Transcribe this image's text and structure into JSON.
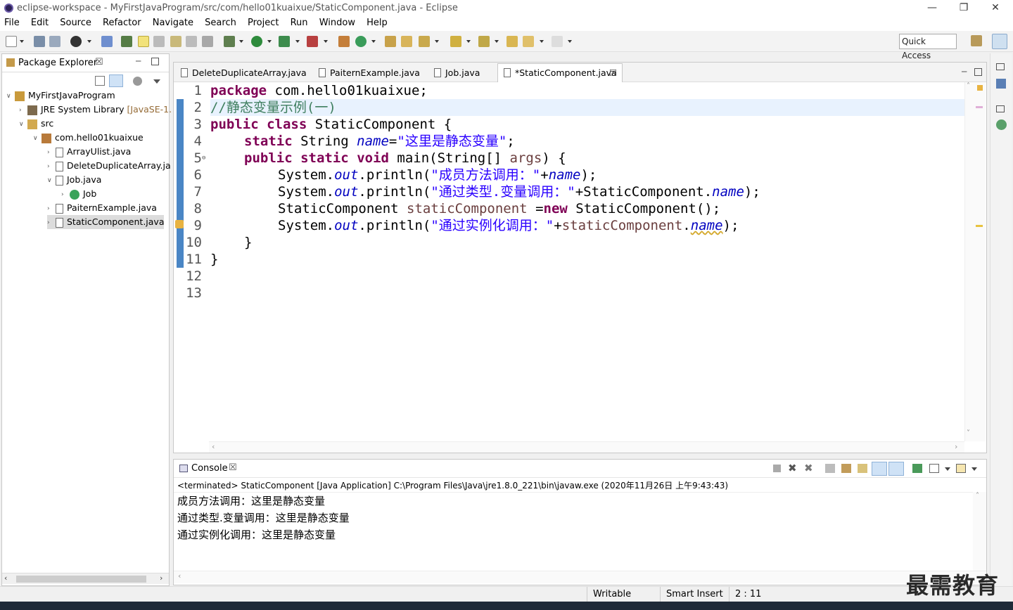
{
  "window": {
    "title": "eclipse-workspace - MyFirstJavaProgram/src/com/hello01kuaixue/StaticComponent.java - Eclipse",
    "minimize": "—",
    "restore": "❐",
    "close": "✕"
  },
  "menu": [
    "File",
    "Edit",
    "Source",
    "Refactor",
    "Navigate",
    "Search",
    "Project",
    "Run",
    "Window",
    "Help"
  ],
  "toolbar": {
    "quick_access": "Quick Access"
  },
  "package_explorer": {
    "title": "Package Explorer",
    "close": "☒",
    "tree": [
      {
        "label": "MyFirstJavaProgram",
        "suffix": "",
        "arrow": "∨",
        "icon": "project-icon"
      },
      {
        "label": "JRE System Library",
        "suffix": " [JavaSE-1.",
        "arrow": "›",
        "icon": "library-icon"
      },
      {
        "label": "src",
        "suffix": "",
        "arrow": "∨",
        "icon": "source-folder-icon"
      },
      {
        "label": "com.hello01kuaixue",
        "suffix": "",
        "arrow": "∨",
        "icon": "package-icon"
      },
      {
        "label": "ArrayUlist.java",
        "suffix": "",
        "arrow": "›",
        "icon": "java-file-icon"
      },
      {
        "label": "DeleteDuplicateArray.ja",
        "suffix": "",
        "arrow": "›",
        "icon": "java-file-icon"
      },
      {
        "label": "Job.java",
        "suffix": "",
        "arrow": "∨",
        "icon": "java-file-icon"
      },
      {
        "label": "Job",
        "suffix": "",
        "arrow": "›",
        "icon": "class-icon"
      },
      {
        "label": "PaiternExample.java",
        "suffix": "",
        "arrow": "›",
        "icon": "java-file-icon"
      },
      {
        "label": "StaticComponent.java",
        "suffix": "",
        "arrow": "›",
        "icon": "java-file-icon"
      }
    ]
  },
  "editor": {
    "tabs": [
      {
        "label": "DeleteDuplicateArray.java"
      },
      {
        "label": "PaiternExample.java"
      },
      {
        "label": "Job.java"
      },
      {
        "label": "*StaticComponent.java",
        "close": "☒"
      }
    ],
    "line_numbers": [
      "1",
      "2",
      "3",
      "4",
      "5",
      "6",
      "7",
      "8",
      "9",
      "10",
      "11",
      "12",
      "13"
    ],
    "code": {
      "l1_kw": "package",
      "l1_rest": " com.hello01kuaixue;",
      "l2": "//静态变量示例(一)",
      "l3_kw1": "public",
      "l3_kw2": "class",
      "l3_rest": " StaticComponent {",
      "l4_kw": "static",
      "l4_type": " String ",
      "l4_field": "name",
      "l4_eq": "=",
      "l4_str": "\"这里是静态变量\"",
      "l4_end": ";",
      "l5_kw1": "public",
      "l5_kw2": "static",
      "l5_kw3": "void",
      "l5_main": " main(String[] ",
      "l5_args": "args",
      "l5_end": ") {",
      "sys": "System.",
      "out": "out",
      "println": ".println(",
      "l6_str": "\"成员方法调用：\"",
      "l6_plus": "+",
      "l6_field": "name",
      "l6_end": ");",
      "l7_str": "\"通过类型.变量调用：\"",
      "l7_mid": "+StaticComponent.",
      "l7_field": "name",
      "l7_end": ");",
      "l8_type": "StaticComponent ",
      "l8_var": "staticComponent",
      "l8_eq": " =",
      "l8_kw": "new",
      "l8_end": " StaticComponent();",
      "l9_str": "\"通过实例化调用：\"",
      "l9_plus": "+",
      "l9_var": "staticComponent",
      "l9_dot": ".",
      "l9_field": "name",
      "l9_end": ");",
      "l10": "}",
      "l11": "}"
    }
  },
  "console": {
    "title": "Console",
    "close": "☒",
    "terminated": "<terminated> StaticComponent [Java Application] C:\\Program Files\\Java\\jre1.8.0_221\\bin\\javaw.exe (2020年11月26日 上午9:43:43)",
    "output": [
      "成员方法调用：这里是静态变量",
      "通过类型.变量调用：这里是静态变量",
      "通过实例化调用：这里是静态变量"
    ]
  },
  "status": {
    "writable": "Writable",
    "insert_mode": "Smart Insert",
    "position": "2 : 11"
  },
  "watermark": "最需教育",
  "colors": {
    "keyword": "#7f0055",
    "string": "#2a00ff",
    "field": "#0000c0",
    "comment": "#3f7f5f",
    "local_var": "#6a3e3e"
  }
}
